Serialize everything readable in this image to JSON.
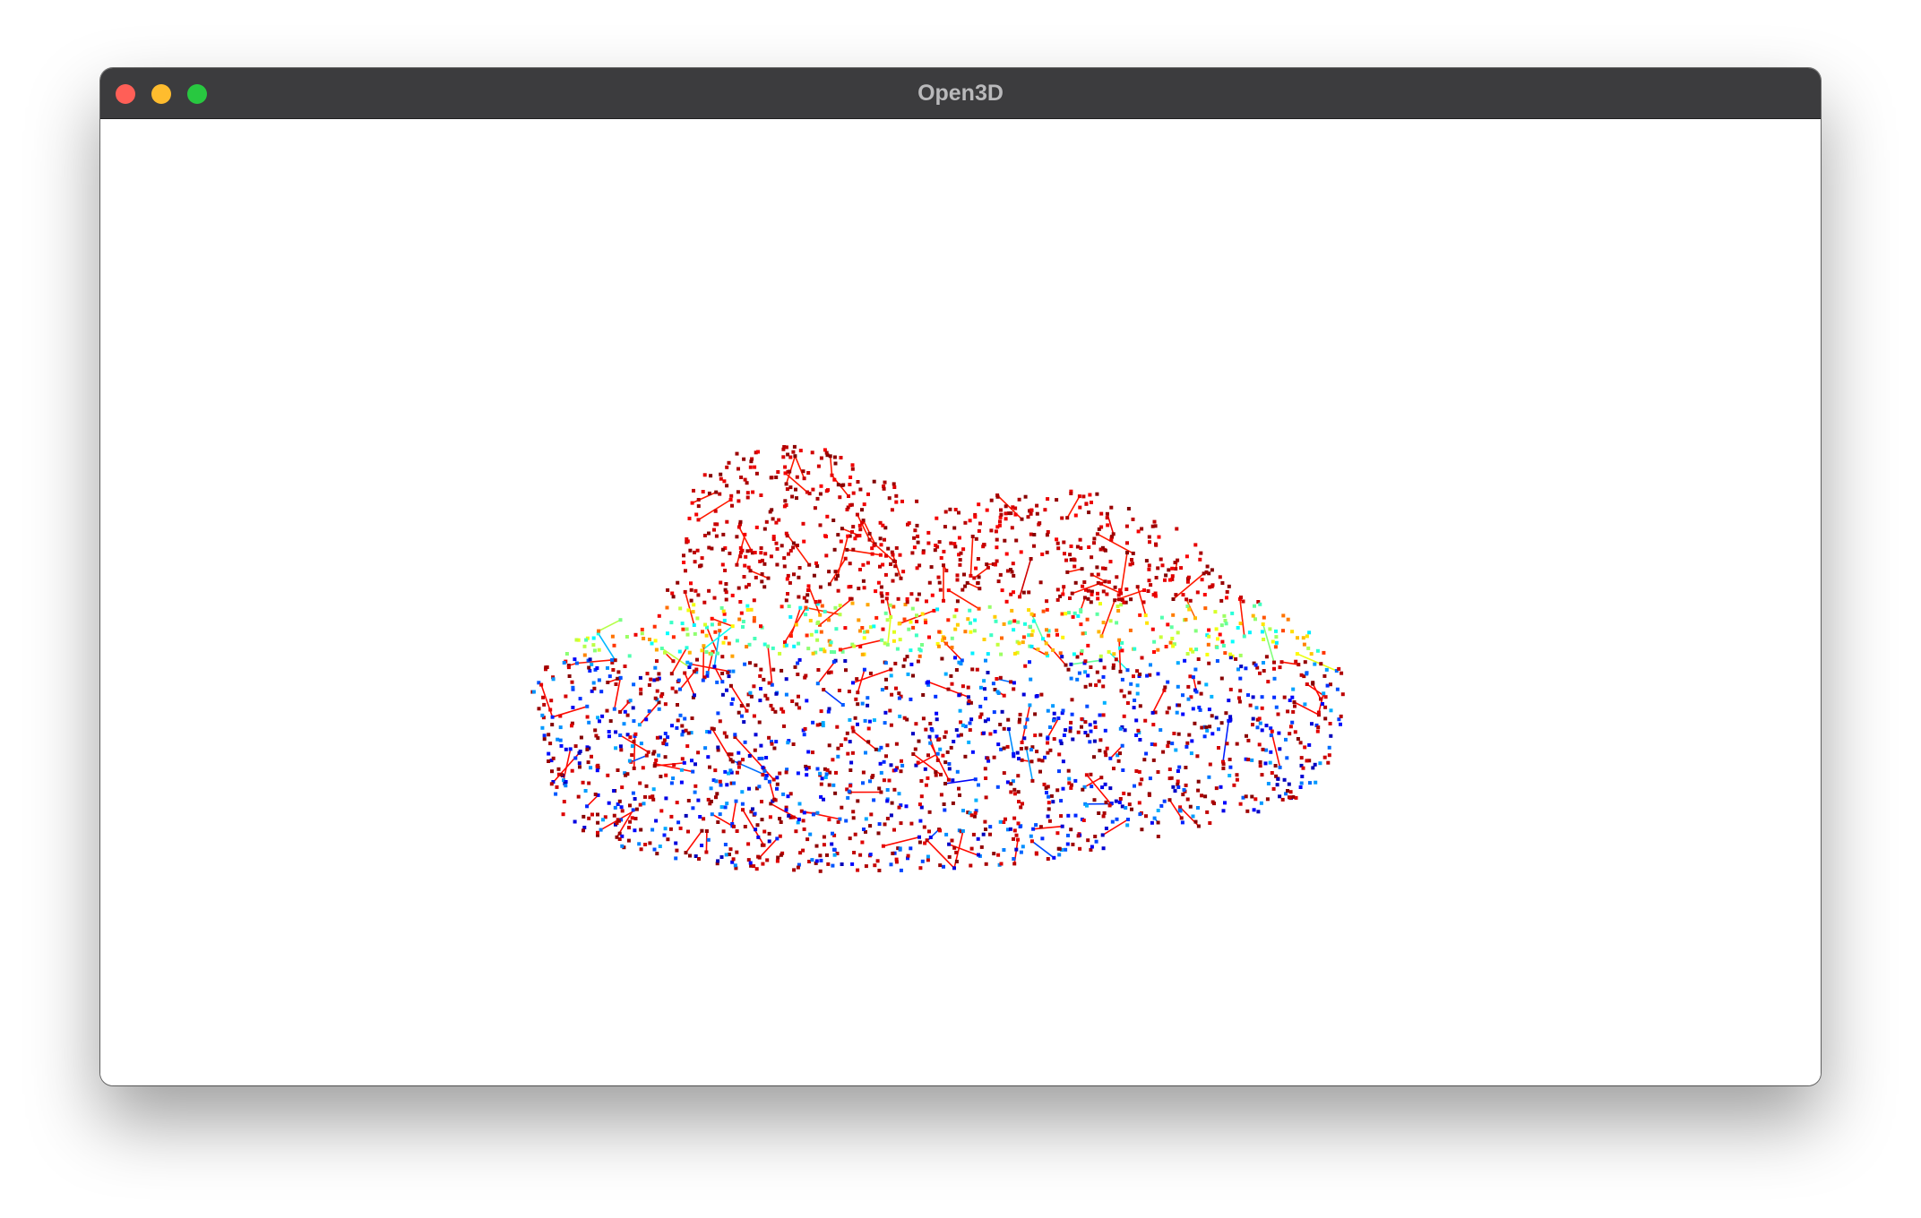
{
  "window": {
    "title": "Open3D"
  },
  "traffic_lights": {
    "close": "close-button",
    "minimize": "minimize-button",
    "maximize": "maximize-button"
  },
  "viewer": {
    "background": "#ffffff",
    "render_mode": "point-cloud-with-lines",
    "colormap": "jet"
  }
}
